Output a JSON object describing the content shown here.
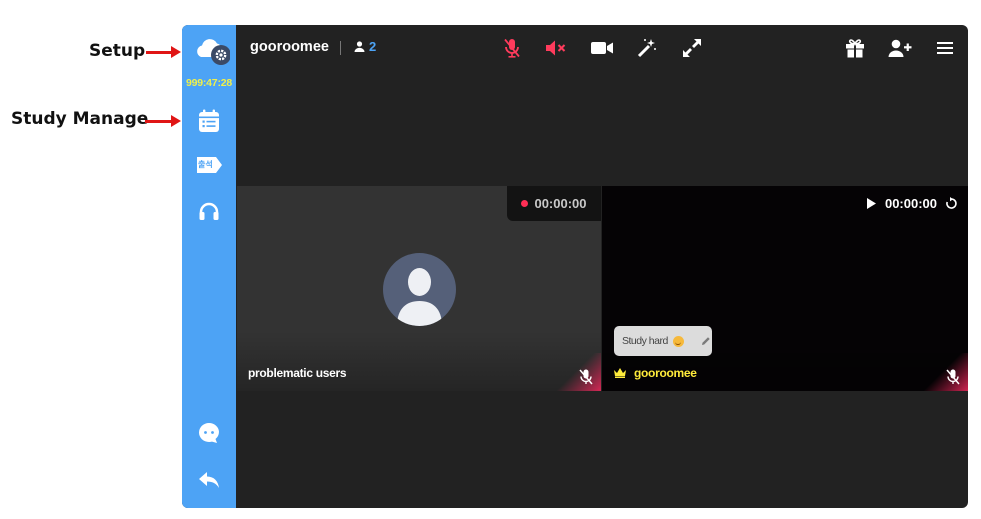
{
  "annotations": {
    "setup": "Setup",
    "study_manage": "Study Manage"
  },
  "sidebar": {
    "timer": "999:47:28",
    "items": [
      {
        "name": "settings",
        "icon": "cloud-gear-icon"
      },
      {
        "name": "study-manage",
        "icon": "calendar-list-icon"
      },
      {
        "name": "attendance",
        "icon": "tag-icon",
        "label": "출석"
      },
      {
        "name": "audio",
        "icon": "headphones-icon"
      },
      {
        "name": "chat",
        "icon": "chat-bubble-icon"
      },
      {
        "name": "exit",
        "icon": "reply-arrow-icon"
      }
    ]
  },
  "header": {
    "room_name": "gooroomee",
    "participant_count": "2",
    "controls": [
      "mic-muted-icon",
      "speaker-muted-icon",
      "camera-icon",
      "magic-wand-icon",
      "fullscreen-icon"
    ],
    "right_controls": [
      "gift-icon",
      "add-user-icon",
      "menu-icon"
    ]
  },
  "tiles": [
    {
      "username": "problematic users",
      "timer": "00:00:00",
      "recording": true,
      "mic_muted": true
    },
    {
      "username": "gooroomee",
      "timer": "00:00:00",
      "host": true,
      "status": "Study hard",
      "mic_muted": true
    }
  ],
  "colors": {
    "sidebar": "#4da3f5",
    "timer": "#f0f04a",
    "muted": "#ff3b5c",
    "background": "#222222",
    "host_name": "#ffeb3b"
  }
}
